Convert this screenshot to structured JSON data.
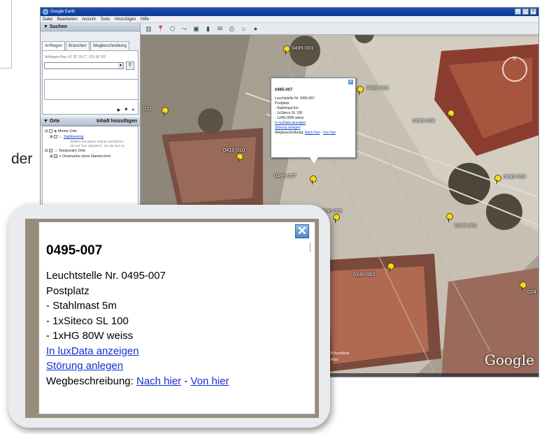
{
  "slide": {
    "text_fragment": "der"
  },
  "window": {
    "title": "Google Earth",
    "controls": [
      "_",
      "□",
      "✕"
    ]
  },
  "menu": [
    "Datei",
    "Bearbeiten",
    "Ansicht",
    "Tools",
    "Hinzufügen",
    "Hilfe"
  ],
  "search": {
    "header": "▼ Suchen",
    "tabs": [
      "Anfliegen",
      "Branchen",
      "Wegbeschreibung"
    ],
    "hint": "Anfliegen Bsp: 47 25' 18,7\", 123 68' 58\"",
    "input_value": "",
    "button_icon": "search-icon",
    "controls": [
      "▶",
      "■",
      "✕"
    ]
  },
  "places": {
    "header": "▼ Orte",
    "add_content": "Inhalt hinzufügen",
    "items": [
      {
        "label": "Meine Orte",
        "link": false,
        "checked": false
      },
      {
        "label": "Sightseeing",
        "link": true,
        "checked": false
      },
      {
        "label": "Wählen Sie diesen Ordner und klicken",
        "link": false,
        "note": true
      },
      {
        "label": "Sie auf 'Tour abspielen', um die Tour zu",
        "link": false,
        "note": true
      },
      {
        "label": "Temporäre Orte",
        "link": false,
        "checked": true
      },
      {
        "label": "Ortsmarke ohne Namen.kml",
        "link": false,
        "checked": true
      }
    ]
  },
  "toolbar": {
    "icons": [
      "sidebar-icon",
      "placemark-icon",
      "polygon-icon",
      "path-icon",
      "overlay-icon",
      "ruler-icon",
      "email-icon",
      "print-icon",
      "map-icon",
      "sky-icon"
    ]
  },
  "map": {
    "markers": [
      {
        "label": "0495-001"
      },
      {
        "label": "0495-006"
      },
      {
        "label": "0495-008"
      },
      {
        "label": "0495-009"
      },
      {
        "label": "0411-010"
      },
      {
        "label": "0495-007"
      },
      {
        "label": "0240-001"
      },
      {
        "label": "0240-003"
      },
      {
        "label": "0240-002"
      },
      {
        "label": "024"
      },
      {
        "label": "011"
      }
    ],
    "street_label": "contro",
    "credits": [
      "Image © 2009 AeroWest",
      "© 2009 Tele Atlas"
    ],
    "logo": "Google"
  },
  "popup": {
    "title": "0495-007",
    "lines": [
      "Leuchtstelle Nr. 0495-007",
      "Postplatz",
      "- Stahlmast 5m",
      "- 1xSiteco SL 100",
      "- 1xHG 80W weiss"
    ],
    "link_luxdata": "In luxData anzeigen",
    "link_stoerung": "Störung anlegen",
    "directions_label": "Wegbeschreibung:",
    "link_nach": "Nach hier",
    "separator": "-",
    "link_von": "Von hier",
    "close": "✕"
  },
  "colors": {
    "marker": "#f2dd1f",
    "link": "#1430d0",
    "titlebar": "#1e4fb0"
  }
}
